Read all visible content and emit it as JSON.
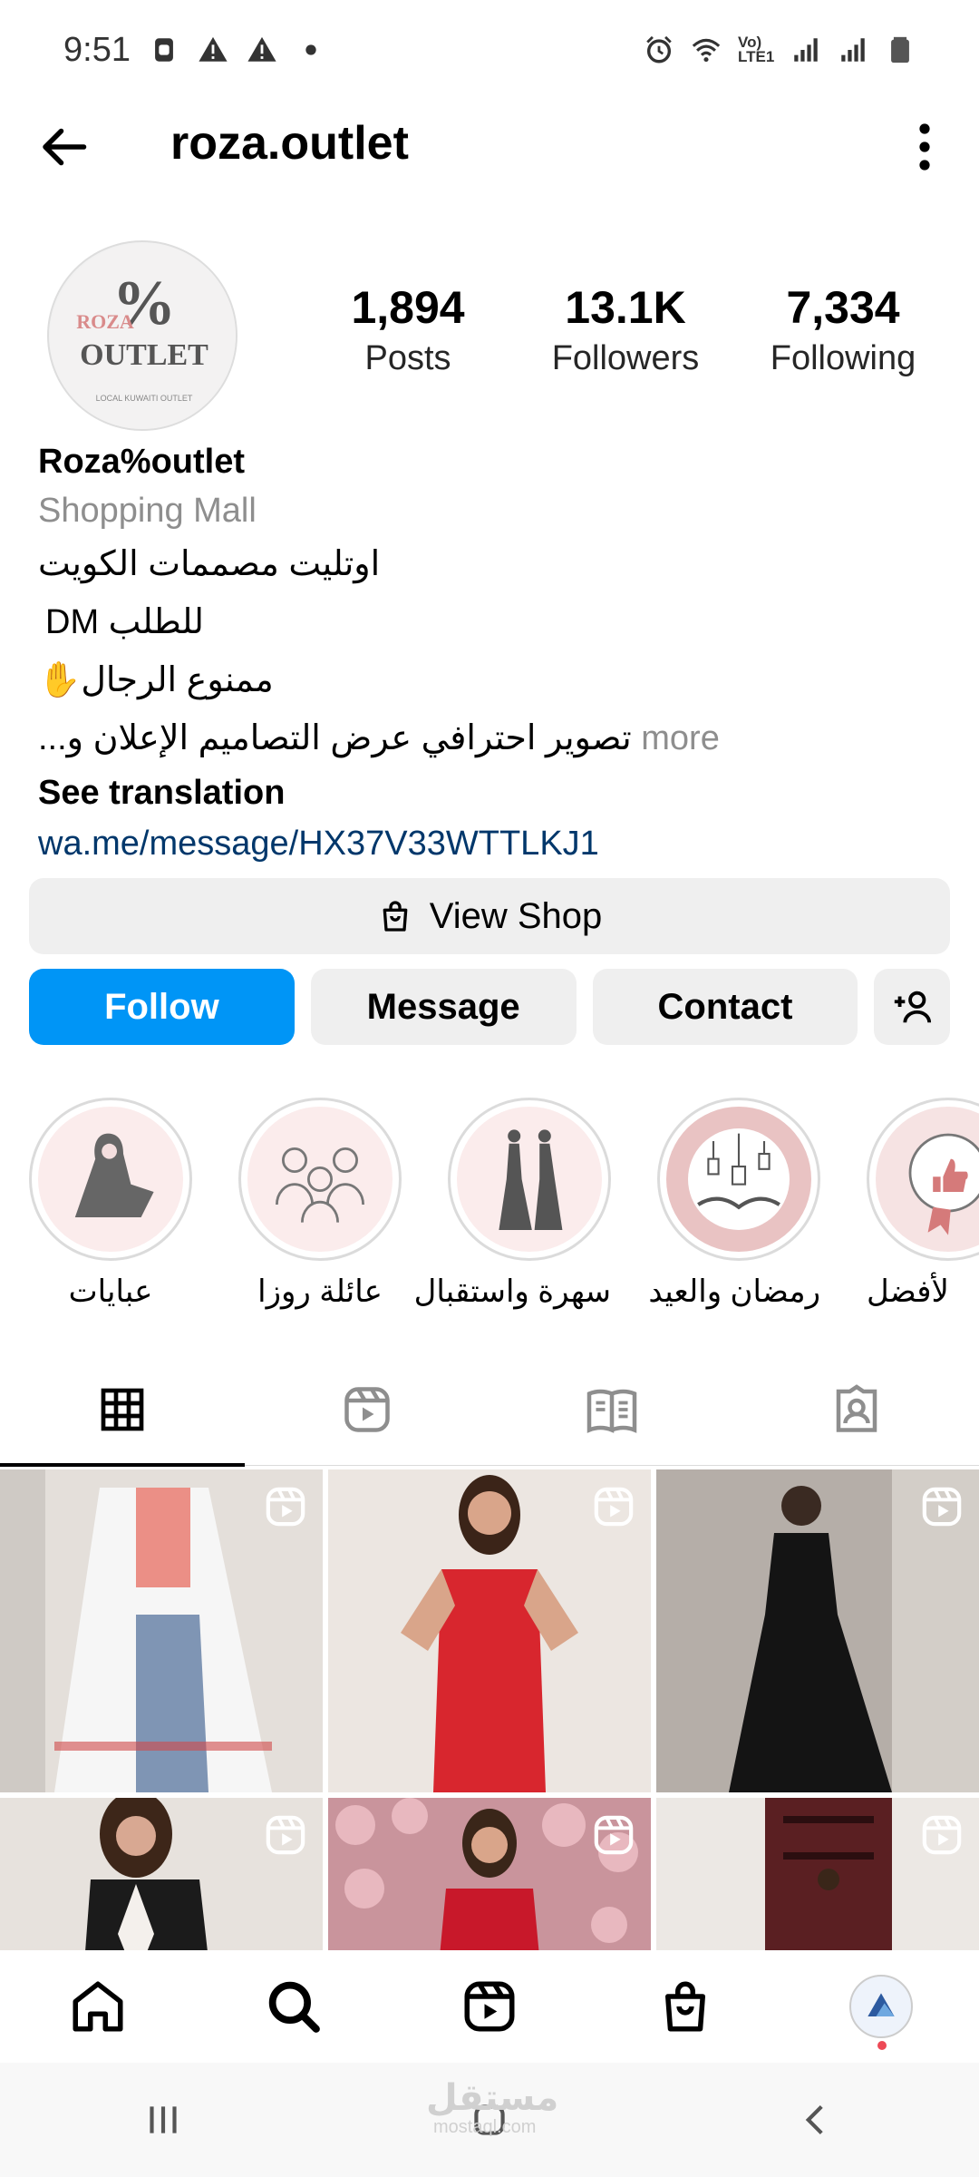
{
  "status_bar": {
    "time": "9:51",
    "network_label": "Vo) LTE1",
    "icons": [
      "screenshot-icon",
      "warning-icon",
      "warning-icon",
      "dot-icon",
      "alarm-icon",
      "wifi-icon",
      "signal-icon",
      "signal-icon",
      "battery-icon"
    ]
  },
  "header": {
    "username": "roza.outlet"
  },
  "profile": {
    "avatar_text_top": "ROZA",
    "avatar_text_main": "OUTLET",
    "avatar_text_percent": "%",
    "avatar_text_ring": "LOCAL KUWAITI OUTLET",
    "stats": [
      {
        "value": "1,894",
        "label": "Posts"
      },
      {
        "value": "13.1K",
        "label": "Followers"
      },
      {
        "value": "7,334",
        "label": "Following"
      }
    ],
    "name": "Roza%outlet",
    "category": "Shopping Mall",
    "bio_lines": [
      "اوتليت مصممات الكويت",
      "للطلب DM",
      "ممنوع الرجال✋",
      "تصوير احترافي عرض التصاميم الإعلان و..."
    ],
    "bio_more": "more",
    "see_translation": "See translation",
    "link": "wa.me/message/HX37V33WTTLKJ1"
  },
  "actions": {
    "view_shop": "View Shop",
    "follow": "Follow",
    "message": "Message",
    "contact": "Contact"
  },
  "highlights": [
    {
      "label": "عبايات"
    },
    {
      "label": "عائلة روزا"
    },
    {
      "label": "سهرة واستقبال"
    },
    {
      "label": "رمضان والعيد"
    },
    {
      "label": "لأفضل"
    }
  ],
  "tabs": [
    "grid-icon",
    "reels-icon",
    "guides-icon",
    "tagged-icon"
  ],
  "posts": [
    {
      "bg": "#e9e4df",
      "accent": "#f2f2f2"
    },
    {
      "bg": "#eadfd8",
      "accent": "#d8262e"
    },
    {
      "bg": "#b9b3ad",
      "accent": "#151515"
    },
    {
      "bg": "#e6e1dc",
      "accent": "#1a1a1a"
    },
    {
      "bg": "#d9a6ad",
      "accent": "#c8182a"
    },
    {
      "bg": "#e9e4df",
      "accent": "#5a1f22"
    }
  ],
  "bottom_nav": [
    "home-icon",
    "search-icon",
    "reels-icon",
    "shop-icon",
    "profile-avatar"
  ],
  "watermark": {
    "text": "مستقل",
    "sub": "mostaql.com"
  },
  "colors": {
    "follow_blue": "#0095f6",
    "link_blue": "#00376b",
    "muted": "#8e8e8e",
    "notification_red": "#ed4956"
  }
}
